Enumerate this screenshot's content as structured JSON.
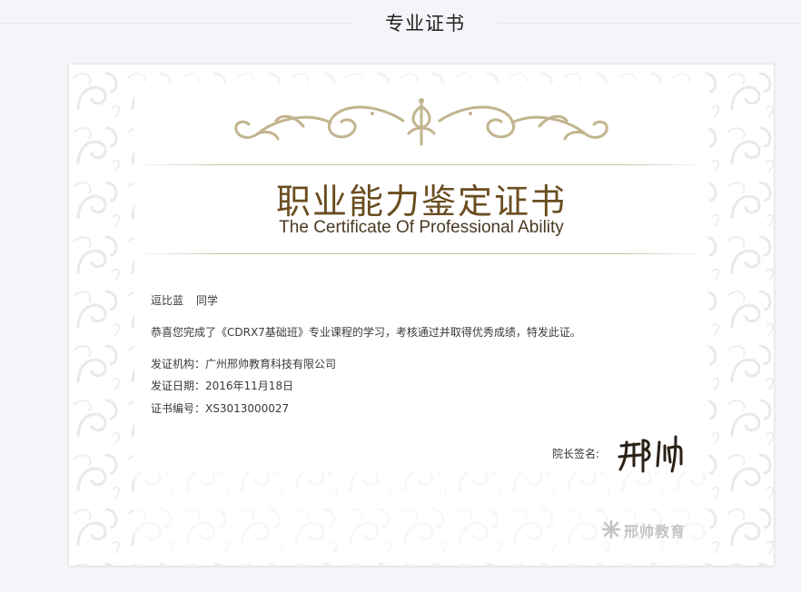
{
  "page": {
    "title": "专业证书"
  },
  "certificate": {
    "title_cn": "职业能力鉴定证书",
    "title_en": "The Certificate Of Professional Ability",
    "recipient_name": "逗比蓝",
    "recipient_suffix": "同学",
    "message": "恭喜您完成了《CDRX7基础班》专业课程的学习，考核通过并取得优秀成绩，特发此证。",
    "issuer": "发证机构：广州邢帅教育科技有限公司",
    "date": "发证日期：2016年11月18日",
    "number": "证书编号：XS3013000027",
    "signature_label": "院长签名:",
    "signature": "邢帅",
    "brand": "邢帅教育"
  },
  "colors": {
    "title": "#6a4d1f",
    "ornament": "#c2b48e",
    "page_bg": "#f3f5f8",
    "brand": "#c4c4c4"
  },
  "icons": [
    "ornament-flourish",
    "brand-logo-icon",
    "signature-image"
  ]
}
